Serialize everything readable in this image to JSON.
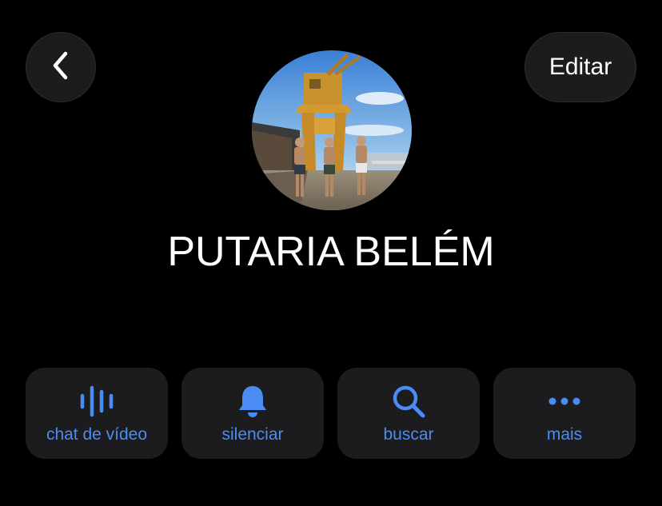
{
  "header": {
    "back_icon": "chevron-left-icon",
    "edit_label": "Editar"
  },
  "profile": {
    "avatar_description": "photo",
    "name": "PUTARIA BELÉM"
  },
  "actions": [
    {
      "icon": "audio-waveform-icon",
      "label": "chat de vídeo"
    },
    {
      "icon": "bell-icon",
      "label": "silenciar"
    },
    {
      "icon": "search-icon",
      "label": "buscar"
    },
    {
      "icon": "ellipsis-icon",
      "label": "mais"
    }
  ],
  "colors": {
    "background": "#000000",
    "button_background": "#1c1c1e",
    "accent": "#4a8cf3",
    "text": "#ffffff"
  }
}
